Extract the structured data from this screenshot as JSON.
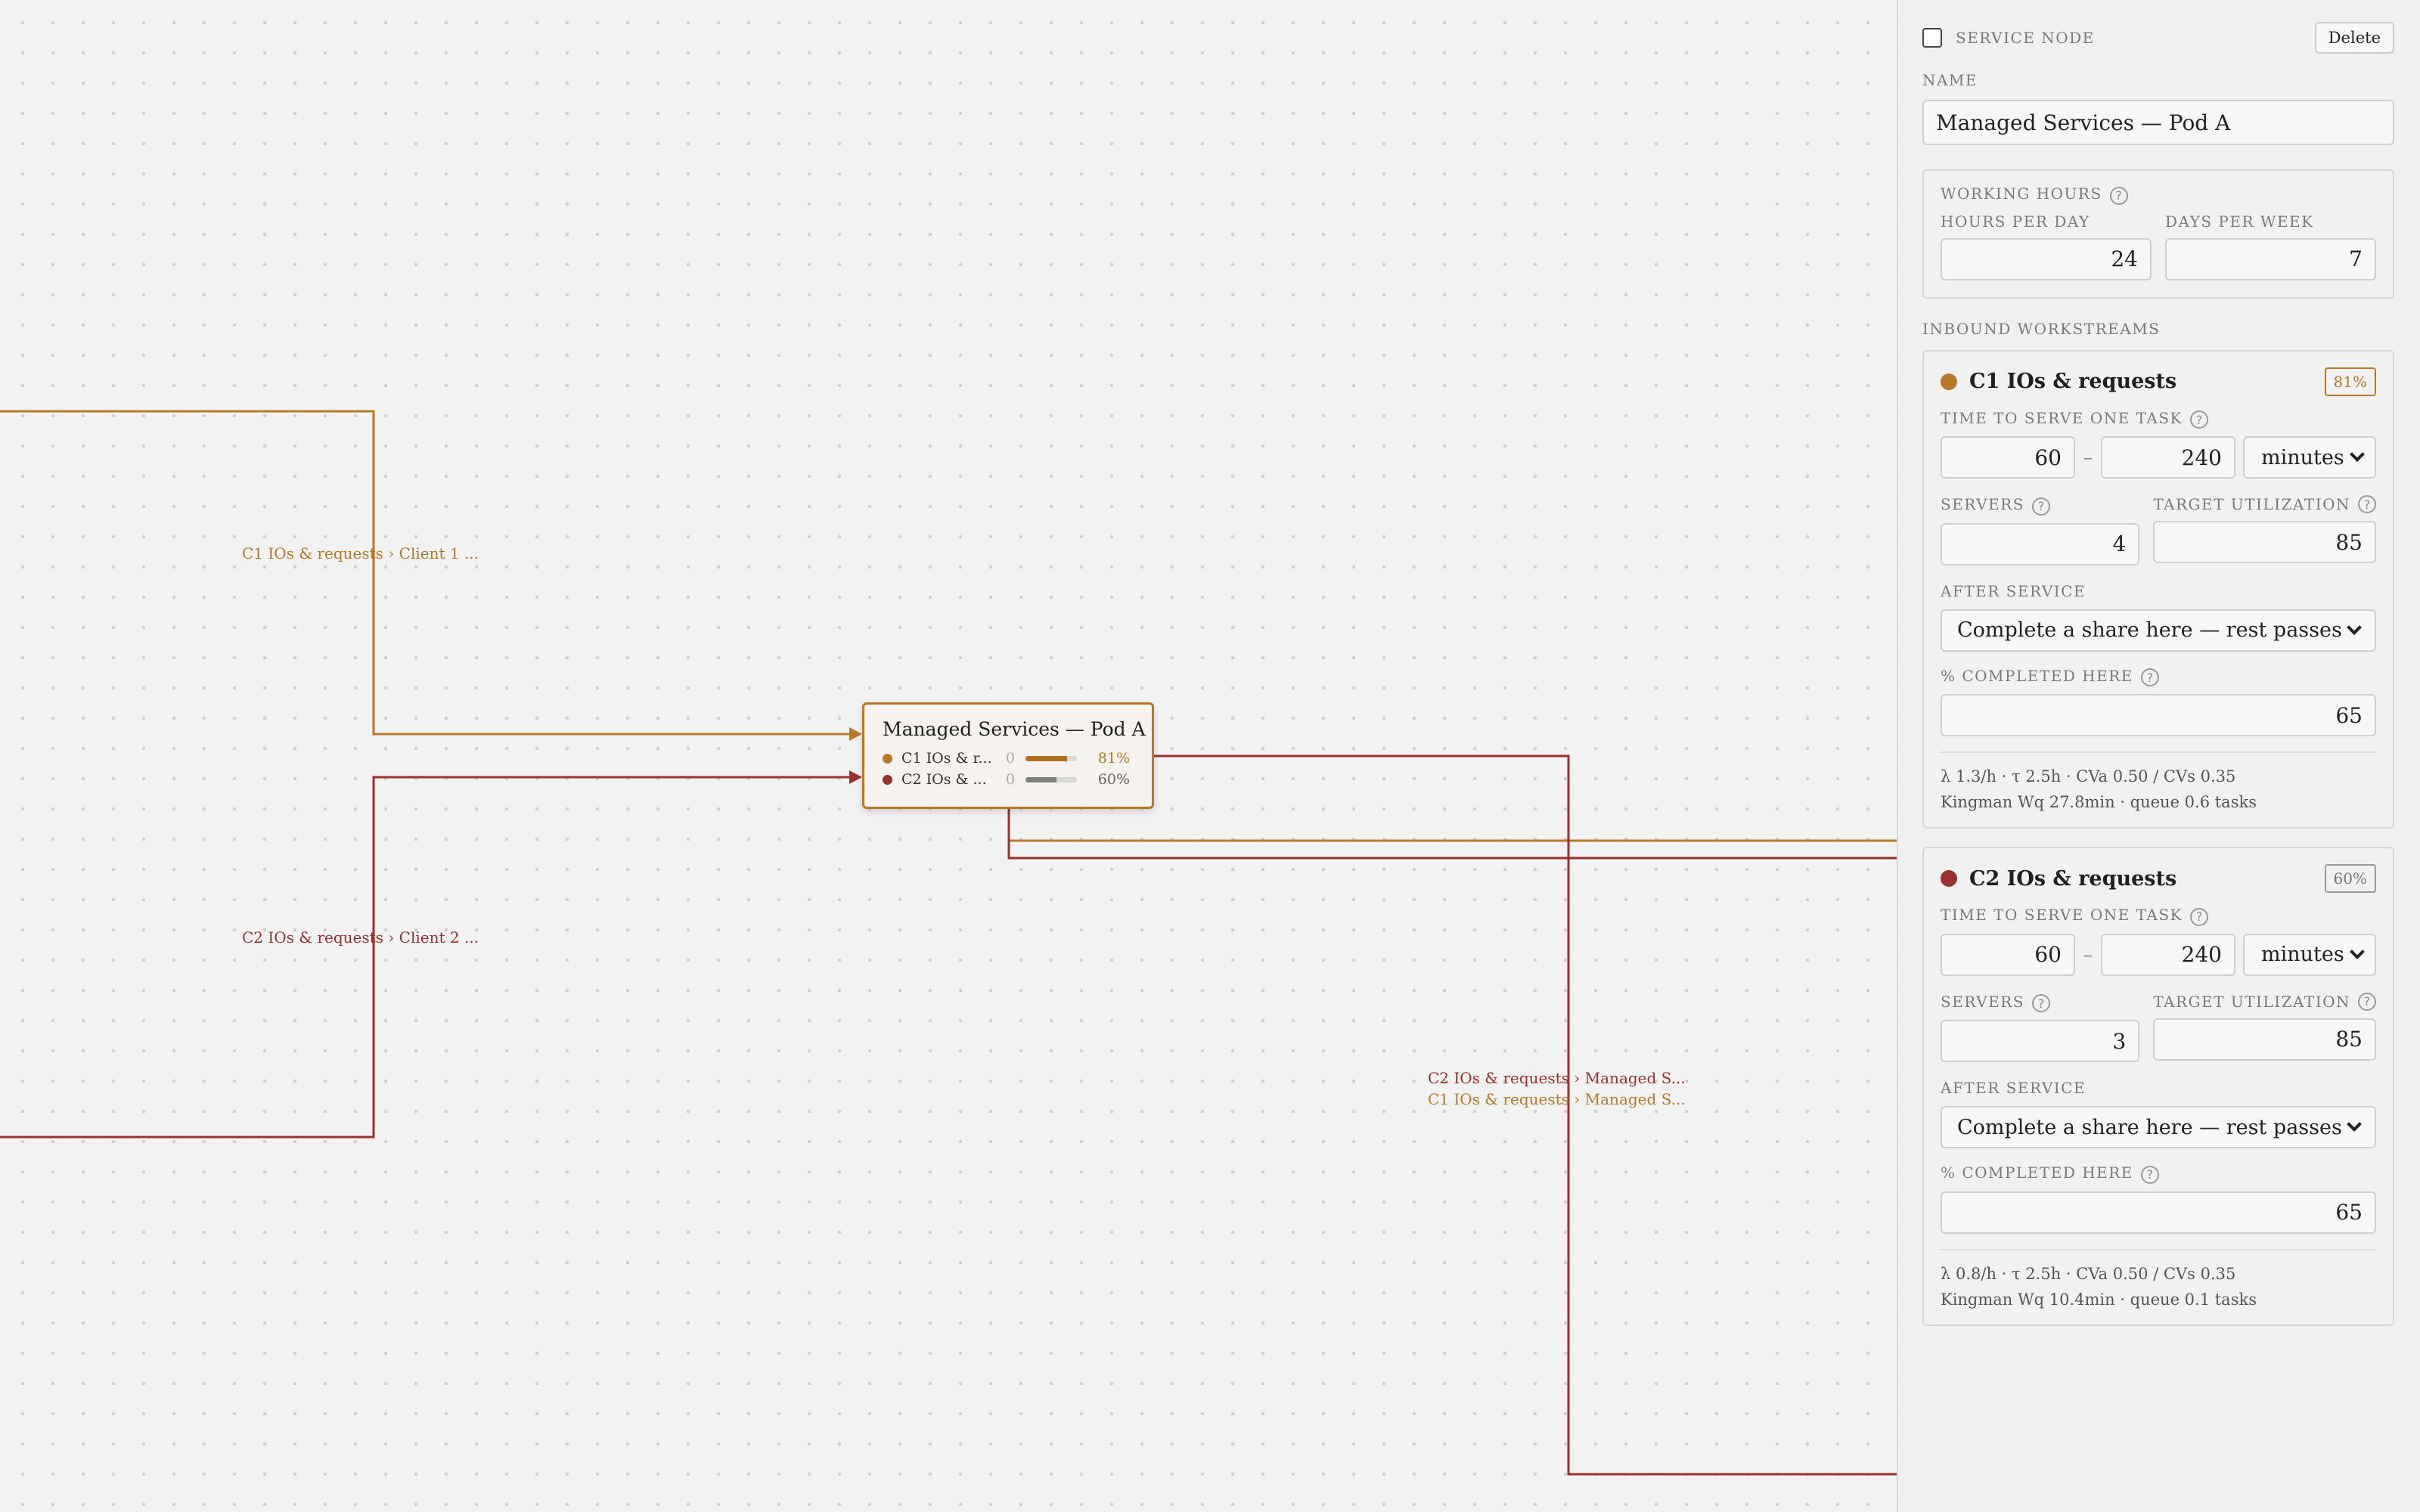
{
  "canvas": {
    "edge_labels": [
      {
        "text": "C1 IOs & requests › Client 1 ...",
        "stream": "c1"
      },
      {
        "text": "C2 IOs & requests › Client 2 ...",
        "stream": "c2"
      },
      {
        "text": "C2 IOs & requests › Managed S...",
        "stream": "c2"
      },
      {
        "text": "C1 IOs & requests › Managed S...",
        "stream": "c1"
      }
    ],
    "node": {
      "title": "Managed Services — Pod A",
      "rows": [
        {
          "name": "C1 IOs & r...",
          "count": "0",
          "utilization": 0.81,
          "pct_label": "81%"
        },
        {
          "name": "C2 IOs & ...",
          "count": "0",
          "utilization": 0.6,
          "pct_label": "60%"
        }
      ]
    }
  },
  "colors": {
    "c1": "#b8782a",
    "c2": "#9b3030",
    "bar_c1": "#b0701f",
    "bar_c2": "#808080"
  },
  "panel": {
    "type_label": "SERVICE NODE",
    "delete_label": "Delete",
    "name_label": "NAME",
    "name_value": "Managed Services — Pod A",
    "working_hours": {
      "label": "WORKING HOURS",
      "hours_per_day_label": "HOURS PER DAY",
      "hours_per_day": "24",
      "days_per_week_label": "DAYS PER WEEK",
      "days_per_week": "7"
    },
    "inbound_label": "INBOUND WORKSTREAMS",
    "workstreams": [
      {
        "name": "C1 IOs & requests",
        "badge": "81%",
        "time_label": "TIME TO SERVE ONE TASK",
        "time_min": "60",
        "dash": "–",
        "time_max": "240",
        "unit": "minutes",
        "servers_label": "SERVERS",
        "servers": "4",
        "target_label": "TARGET UTILIZATION",
        "target": "85",
        "after_label": "AFTER SERVICE",
        "after_value": "Complete a share here — rest passes",
        "completed_label": "% COMPLETED HERE",
        "completed": "65",
        "stats_line1": "λ 1.3/h · τ 2.5h · CVa 0.50 / CVs 0.35",
        "stats_line2": "Kingman Wq 27.8min · queue 0.6 tasks"
      },
      {
        "name": "C2 IOs & requests",
        "badge": "60%",
        "time_label": "TIME TO SERVE ONE TASK",
        "time_min": "60",
        "dash": "–",
        "time_max": "240",
        "unit": "minutes",
        "servers_label": "SERVERS",
        "servers": "3",
        "target_label": "TARGET UTILIZATION",
        "target": "85",
        "after_label": "AFTER SERVICE",
        "after_value": "Complete a share here — rest passes",
        "completed_label": "% COMPLETED HERE",
        "completed": "65",
        "stats_line1": "λ 0.8/h · τ 2.5h · CVa 0.50 / CVs 0.35",
        "stats_line2": "Kingman Wq 10.4min · queue 0.1 tasks"
      }
    ]
  }
}
